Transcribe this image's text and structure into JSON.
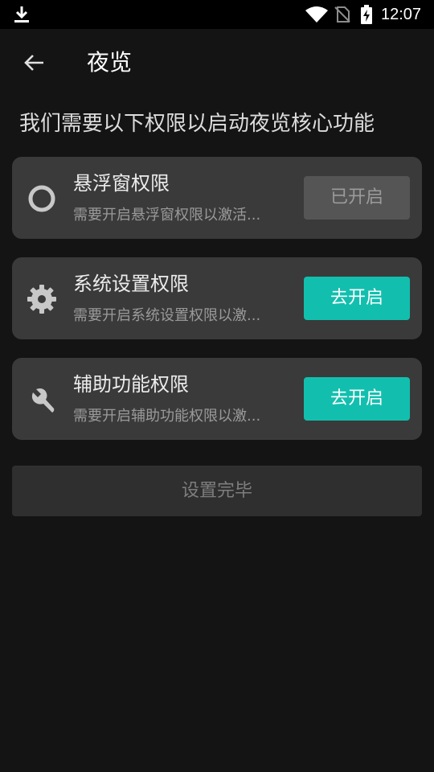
{
  "status_bar": {
    "time": "12:07",
    "icons": [
      "download-icon",
      "wifi-icon",
      "no-sim-icon",
      "battery-charging-icon"
    ]
  },
  "app_bar": {
    "back_icon": "arrow-left-icon",
    "title": "夜览"
  },
  "intro": "我们需要以下权限以启动夜览核心功能",
  "permissions": [
    {
      "icon": "circle-ring-icon",
      "title": "悬浮窗权限",
      "desc": "需要开启悬浮窗权限以激活...",
      "button": "已开启",
      "state": "enabled"
    },
    {
      "icon": "gear-icon",
      "title": "系统设置权限",
      "desc": "需要开启系统设置权限以激...",
      "button": "去开启",
      "state": "disabled"
    },
    {
      "icon": "wrench-icon",
      "title": "辅助功能权限",
      "desc": "需要开启辅助功能权限以激...",
      "button": "去开启",
      "state": "disabled"
    }
  ],
  "finish_button": "设置完毕",
  "colors": {
    "background": "#141414",
    "card": "#3a3a3a",
    "accent": "#12bfae",
    "button_disabled": "#555555"
  }
}
